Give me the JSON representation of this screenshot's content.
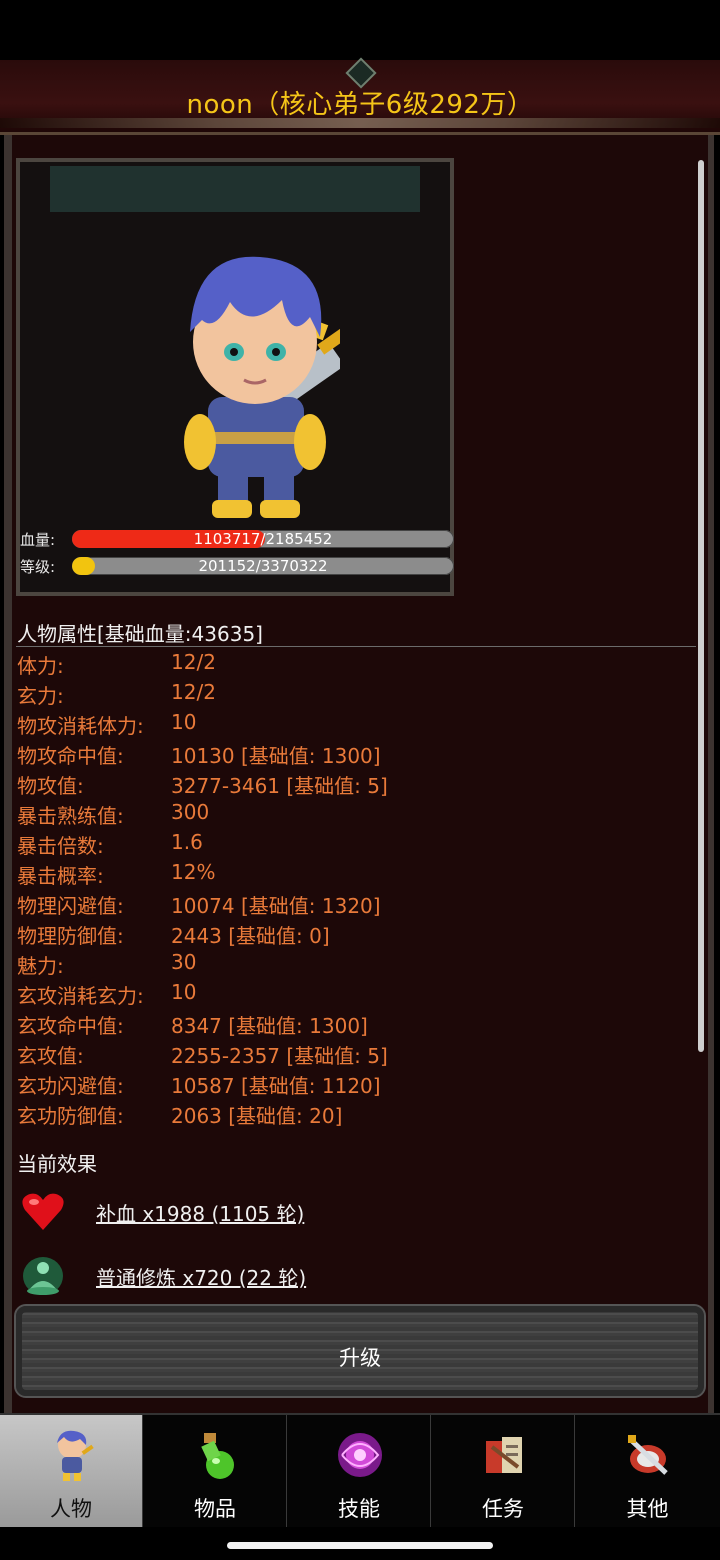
{
  "header": {
    "title": "noon（核心弟子6级292万）"
  },
  "portrait": {
    "hp": {
      "label": "血量:",
      "current": 1103717,
      "max": 2185452,
      "text": "1103717/2185452",
      "fraction": 0.505,
      "color": "#ee2a17"
    },
    "level": {
      "label": "等级:",
      "current": 201152,
      "max": 3370322,
      "text": "201152/3370322",
      "fraction": 0.06,
      "color": "#f2c40f"
    }
  },
  "attributes": {
    "title": "人物属性[基础血量:43635]",
    "rows": [
      {
        "label": "体力:",
        "value": "12/2"
      },
      {
        "label": "玄力:",
        "value": "12/2"
      },
      {
        "label": "物攻消耗体力:",
        "value": "10"
      },
      {
        "label": "物攻命中值:",
        "value": "10130 [基础值: 1300]"
      },
      {
        "label": "物攻值:",
        "value": "3277-3461 [基础值: 5]"
      },
      {
        "label": "暴击熟练值:",
        "value": "300"
      },
      {
        "label": "暴击倍数:",
        "value": "1.6"
      },
      {
        "label": "暴击概率:",
        "value": "12%"
      },
      {
        "label": "物理闪避值:",
        "value": "10074 [基础值: 1320]"
      },
      {
        "label": "物理防御值:",
        "value": "2443 [基础值: 0]"
      },
      {
        "label": "魅力:",
        "value": "30"
      },
      {
        "label": "玄攻消耗玄力:",
        "value": "10"
      },
      {
        "label": "玄攻命中值:",
        "value": "8347 [基础值: 1300]"
      },
      {
        "label": "玄攻值:",
        "value": "2255-2357 [基础值: 5]"
      },
      {
        "label": "玄功闪避值:",
        "value": "10587 [基础值: 1120]"
      },
      {
        "label": "玄功防御值:",
        "value": "2063 [基础值: 20]"
      }
    ]
  },
  "effects": {
    "title": "当前效果",
    "items": [
      {
        "icon": "heart-icon",
        "text": "补血 x1988 (1105 轮)"
      },
      {
        "icon": "meditation-icon",
        "text": "普通修炼 x720 (22 轮)"
      }
    ]
  },
  "upgrade_button": {
    "label": "升级"
  },
  "tabs": [
    {
      "label": "人物",
      "icon": "character-icon",
      "active": true
    },
    {
      "label": "物品",
      "icon": "potion-icon",
      "active": false
    },
    {
      "label": "技能",
      "icon": "skill-orb-icon",
      "active": false
    },
    {
      "label": "任务",
      "icon": "quest-icon",
      "active": false
    },
    {
      "label": "其他",
      "icon": "sword-shield-icon",
      "active": false
    }
  ]
}
